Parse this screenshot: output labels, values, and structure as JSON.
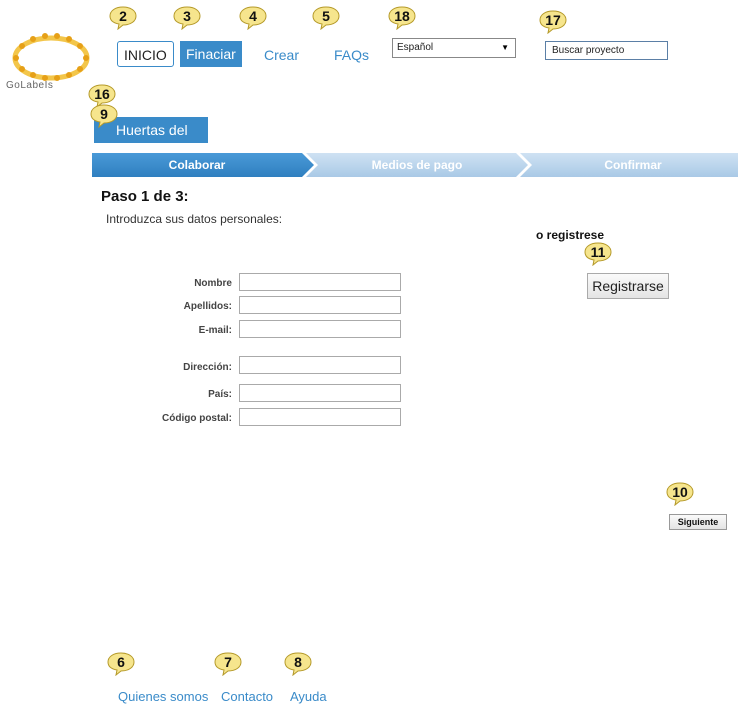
{
  "logo": {
    "text": "GoLabeIs",
    "icon": "people-circle-logo"
  },
  "nav": {
    "inicio": "INICIO",
    "financiar": "Finaciar",
    "crear": "Crear",
    "faqs": "FAQs"
  },
  "language_select": {
    "value": "Español"
  },
  "search": {
    "placeholder": "Buscar proyecto"
  },
  "project_tab": {
    "label": "Huertas del barrio"
  },
  "steps": [
    "Colaborar",
    "Medios de pago",
    "Confirmar"
  ],
  "form": {
    "title": "Paso 1 de 3:",
    "intro": "Introduzca sus datos personales:",
    "fields": [
      {
        "label": "Nombre",
        "value": ""
      },
      {
        "label": "Apellidos:",
        "value": ""
      },
      {
        "label": "E-mail:",
        "value": ""
      },
      {
        "label": "Dirección:",
        "value": ""
      },
      {
        "label": "País:",
        "value": ""
      },
      {
        "label": "Código postal:",
        "value": ""
      }
    ]
  },
  "register": {
    "heading": "o registrese",
    "button": "Registrarse"
  },
  "next_button": "Siguiente",
  "footer": {
    "quienes": "Quienes somos",
    "contacto": "Contacto",
    "ayuda": "Ayuda"
  },
  "annotations": [
    "2",
    "3",
    "4",
    "5",
    "18",
    "17",
    "16",
    "9",
    "11",
    "10",
    "6",
    "7",
    "8"
  ],
  "colors": {
    "accent": "#3a8bc9",
    "step_active": "#3a8bc9",
    "step_inactive": "#b9d3ea",
    "bubble": "#f6e58d"
  }
}
